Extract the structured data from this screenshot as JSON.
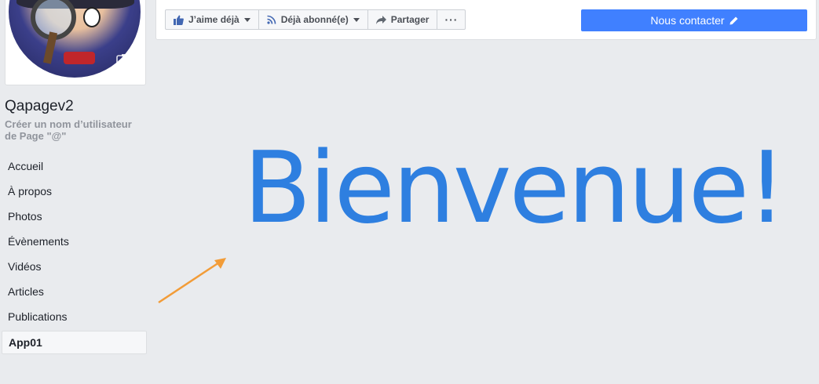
{
  "profile": {
    "page_name": "Qapagev2",
    "username_link": "Créer un nom d’utilisateur de Page \"@\""
  },
  "nav": {
    "items": [
      {
        "label": "Accueil"
      },
      {
        "label": "À propos"
      },
      {
        "label": "Photos"
      },
      {
        "label": "Évènements"
      },
      {
        "label": "Vidéos"
      },
      {
        "label": "Articles"
      },
      {
        "label": "Publications"
      },
      {
        "label": "App01",
        "active": true
      }
    ]
  },
  "actionbar": {
    "like_label": "J’aime déjà",
    "follow_label": "Déjà abonné(e)",
    "share_label": "Partager",
    "more_label": "···",
    "contact_label": "Nous contacter"
  },
  "main": {
    "welcome_text": "Bienvenue!"
  },
  "colors": {
    "background": "#e9ebee",
    "welcome_text": "#2e7fe0",
    "contact_button": "#4080ff",
    "arrow": "#f29c38"
  },
  "icons": [
    "camera-icon",
    "thumbs-up-icon",
    "rss-icon",
    "share-arrow-icon",
    "pencil-icon",
    "chevron-down-icon"
  ]
}
